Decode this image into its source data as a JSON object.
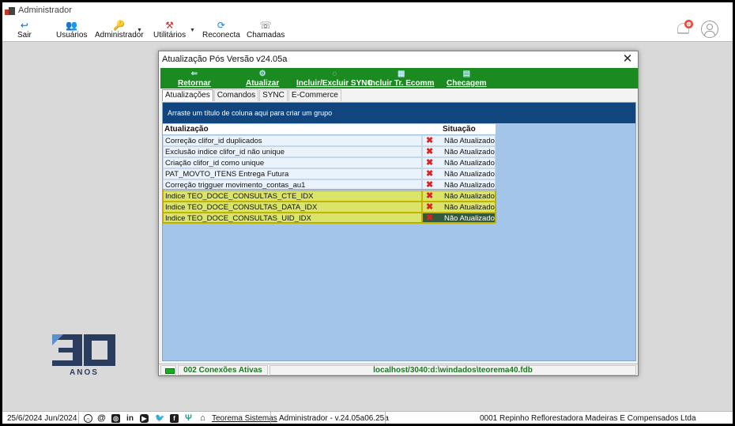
{
  "window": {
    "title": "Administrador"
  },
  "toolbar": {
    "sair": "Sair",
    "usuarios": "Usuários",
    "administrador": "Administrador",
    "utilitarios": "Utilitários",
    "reconecta": "Reconecta",
    "chamadas": "Chamadas",
    "notification_badge": "⊗"
  },
  "logo": {
    "number": "30",
    "text": "ANOS"
  },
  "dialog": {
    "title": "Atualização Pós Versão v24.05a",
    "buttons": {
      "retornar": "Retornar",
      "atualizar": "Atualizar",
      "incluir_sync": "Incluir/Excluir SYNC",
      "incluir_ecomm": "Incluir Tr. Ecomm",
      "checagem": "Checagem"
    },
    "tabs": [
      "Atualizações",
      "Comandos",
      "SYNC",
      "E-Commerce"
    ],
    "group_hint": "Arraste um título de coluna aqui para criar um grupo",
    "columns": {
      "atualizacao": "Atualização",
      "situacao": "Situação"
    },
    "rows": [
      {
        "name": "Correção clifor_id duplicados",
        "status": "Não Atualizado"
      },
      {
        "name": "Exclusão indice clifor_id não unique",
        "status": "Não Atualizado"
      },
      {
        "name": "Criação clifor_id como unique",
        "status": "Não Atualizado"
      },
      {
        "name": "PAT_MOVTO_ITENS Entrega Futura",
        "status": "Não Atualizado"
      },
      {
        "name": "Correção trigguer movimento_contas_au1",
        "status": "Não Atualizado"
      },
      {
        "name": "Indice TEO_DOCE_CONSULTAS_CTE_IDX",
        "status": "Não Atualizado"
      },
      {
        "name": "Indice TEO_DOCE_CONSULTAS_DATA_IDX",
        "status": "Não Atualizado"
      },
      {
        "name": "Indice TEO_DOCE_CONSULTAS_UID_IDX",
        "status": "Não Atualizado"
      }
    ],
    "status": {
      "connections": "002 Conexões Ativas",
      "database": "localhost/3040:d:\\windados\\teorema40.fdb"
    }
  },
  "bottom": {
    "date": "25/6/2024 Jun/2024",
    "company_link": "Teorema Sistemas",
    "version": "Administrador - v.24.05a06.25a",
    "empresa": "0001 Repinho Reflorestadora Madeiras E Compensados Ltda"
  },
  "colors": {
    "green": "#1b8a21",
    "grid_blue": "#a3c5ea",
    "navy": "#10457e",
    "highlight": "#dbe46a"
  }
}
